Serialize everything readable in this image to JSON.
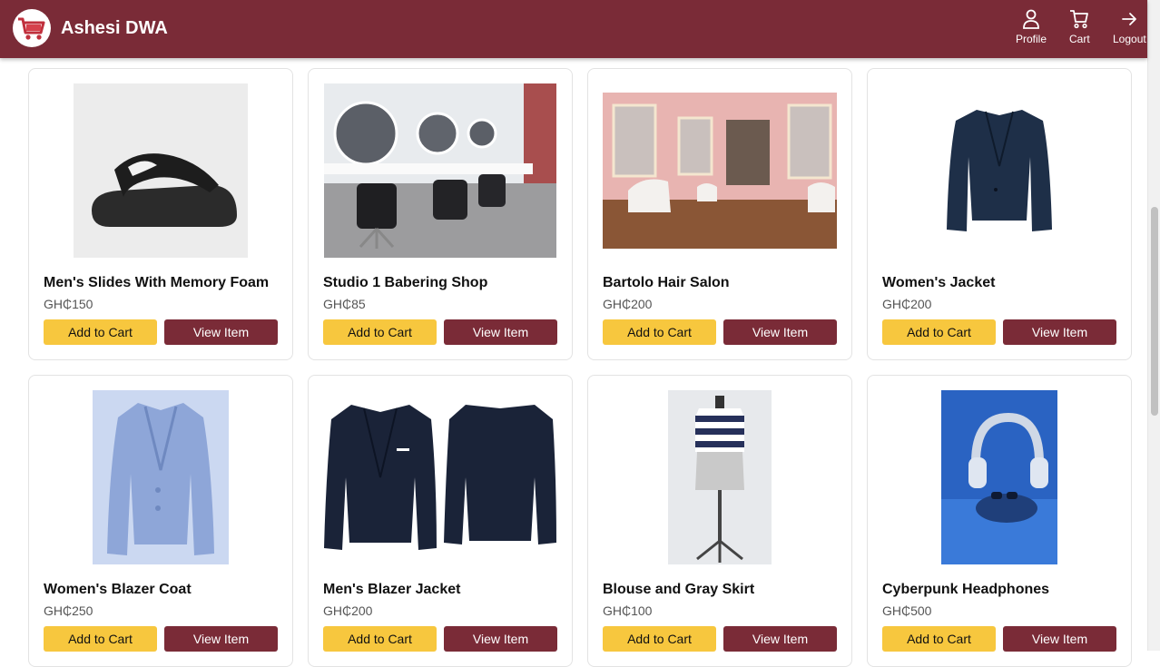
{
  "app": {
    "brand": "Ashesi DWA",
    "logo_icon": "shopping-cart-icon",
    "colors": {
      "primary": "#7a2b37",
      "accent": "#f7c73e"
    }
  },
  "nav": {
    "profile": {
      "label": "Profile",
      "icon": "user-icon"
    },
    "cart": {
      "label": "Cart",
      "icon": "cart-icon"
    },
    "logout": {
      "label": "Logout",
      "icon": "arrow-right-icon"
    }
  },
  "products": [
    {
      "name": "Men's Slides With Memory Foam",
      "price": "GH₵150",
      "add_label": "Add to Cart",
      "view_label": "View Item",
      "image": "black-slide-sandal"
    },
    {
      "name": "Studio 1 Babering Shop",
      "price": "GH₵85",
      "add_label": "Add to Cart",
      "view_label": "View Item",
      "image": "barber-shop-interior"
    },
    {
      "name": "Bartolo Hair Salon",
      "price": "GH₵200",
      "add_label": "Add to Cart",
      "view_label": "View Item",
      "image": "pink-hair-salon-interior"
    },
    {
      "name": "Women's Jacket",
      "price": "GH₵200",
      "add_label": "Add to Cart",
      "view_label": "View Item",
      "image": "navy-womens-jacket"
    },
    {
      "name": "Women's Blazer Coat",
      "price": "GH₵250",
      "add_label": "Add to Cart",
      "view_label": "View Item",
      "image": "light-blue-blazer"
    },
    {
      "name": "Men's Blazer Jacket",
      "price": "GH₵200",
      "add_label": "Add to Cart",
      "view_label": "View Item",
      "image": "navy-mens-blazer-front-back"
    },
    {
      "name": "Blouse and Gray Skirt",
      "price": "GH₵100",
      "add_label": "Add to Cart",
      "view_label": "View Item",
      "image": "striped-blouse-on-mannequin"
    },
    {
      "name": "Cyberpunk Headphones",
      "price": "GH₵500",
      "add_label": "Add to Cart",
      "view_label": "View Item",
      "image": "blue-headphones"
    }
  ]
}
